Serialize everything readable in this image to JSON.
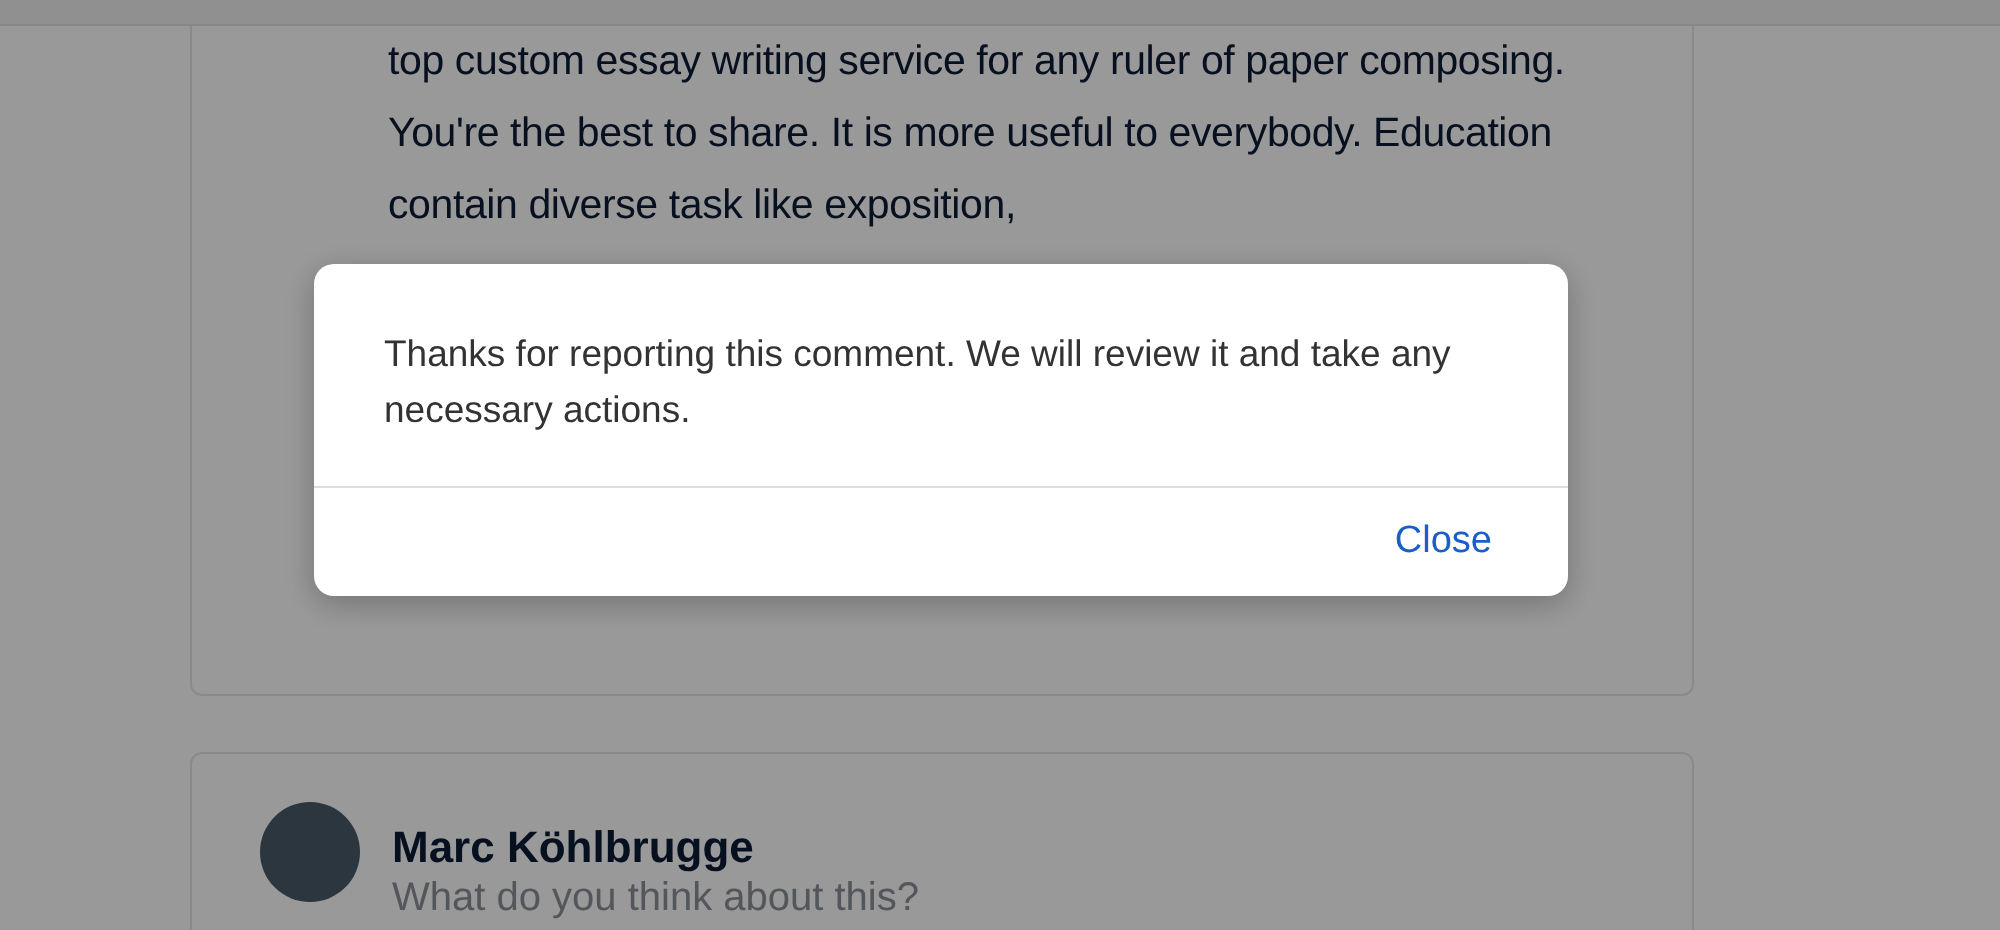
{
  "post": {
    "text": "top custom essay writing service for any ruler of paper composing. You're the best to share. It is more useful to everybody. Education contain diverse task like exposition,"
  },
  "comment_form": {
    "author": "Marc Köhlbrugge",
    "placeholder": "What do you think about this?"
  },
  "dialog": {
    "message": "Thanks for reporting this comment. We will review it and take any necessary actions.",
    "buttons": [
      "Close"
    ]
  }
}
